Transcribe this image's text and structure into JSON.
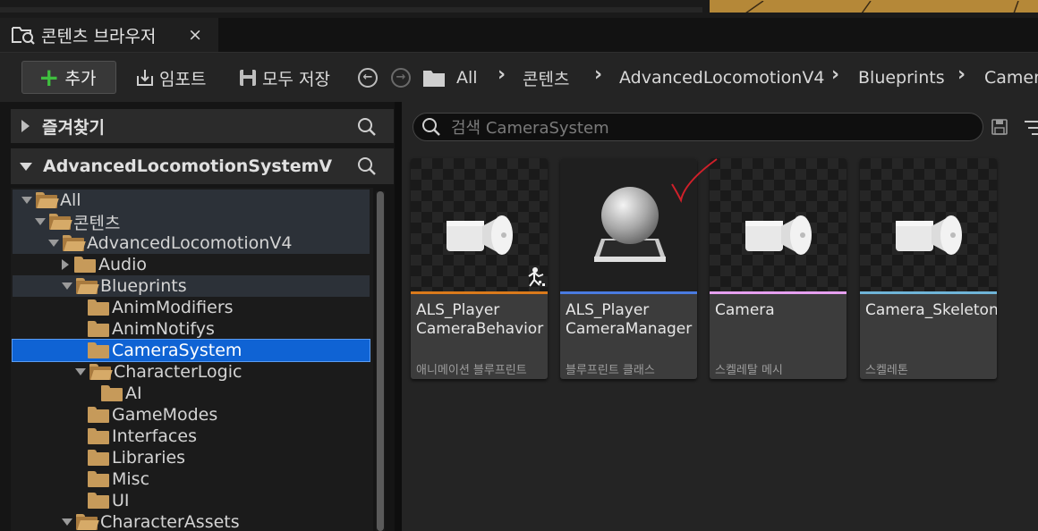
{
  "tab": {
    "title": "콘텐츠 브라우저",
    "close": "×"
  },
  "toolbar": {
    "add_label": "추가",
    "import_label": "임포트",
    "save_all_label": "모두 저장"
  },
  "breadcrumbs": [
    "All",
    "콘텐츠",
    "AdvancedLocomotionV4",
    "Blueprints",
    "Camera"
  ],
  "sidebar": {
    "favorites_title": "즐겨찾기",
    "project_title": "AdvancedLocomotionSystemV",
    "tree": [
      {
        "label": "All",
        "depth": 0,
        "expanded": true,
        "state": "hl"
      },
      {
        "label": "콘텐츠",
        "depth": 1,
        "expanded": true,
        "state": "hl"
      },
      {
        "label": "AdvancedLocomotionV4",
        "depth": 2,
        "expanded": true,
        "state": "hl"
      },
      {
        "label": "Audio",
        "depth": 3,
        "expanded": false,
        "state": ""
      },
      {
        "label": "Blueprints",
        "depth": 3,
        "expanded": true,
        "state": "hl"
      },
      {
        "label": "AnimModifiers",
        "depth": 4,
        "expanded": null,
        "state": ""
      },
      {
        "label": "AnimNotifys",
        "depth": 4,
        "expanded": null,
        "state": ""
      },
      {
        "label": "CameraSystem",
        "depth": 4,
        "expanded": null,
        "state": "sel"
      },
      {
        "label": "CharacterLogic",
        "depth": 4,
        "expanded": true,
        "state": ""
      },
      {
        "label": "AI",
        "depth": 5,
        "expanded": null,
        "state": ""
      },
      {
        "label": "GameModes",
        "depth": 4,
        "expanded": null,
        "state": ""
      },
      {
        "label": "Interfaces",
        "depth": 4,
        "expanded": null,
        "state": ""
      },
      {
        "label": "Libraries",
        "depth": 4,
        "expanded": null,
        "state": ""
      },
      {
        "label": "Misc",
        "depth": 4,
        "expanded": null,
        "state": ""
      },
      {
        "label": "UI",
        "depth": 4,
        "expanded": null,
        "state": ""
      },
      {
        "label": "CharacterAssets",
        "depth": 3,
        "expanded": true,
        "state": ""
      }
    ]
  },
  "search": {
    "placeholder": "검색 CameraSystem"
  },
  "assets": [
    {
      "name_line1": "ALS_Player",
      "name_line2": "CameraBehavior",
      "type": "애니메이션 블루프린트",
      "color": "#d97a1c",
      "icon": "camera-icon"
    },
    {
      "name_line1": "ALS_Player",
      "name_line2": "CameraManager",
      "type": "블루프린트 클래스",
      "color": "#4a7be0",
      "icon": "sphere-icon"
    },
    {
      "name_line1": "Camera",
      "name_line2": "",
      "type": "스켈레탈 메시",
      "color": "#e6a0f0",
      "icon": "camera-icon"
    },
    {
      "name_line1": "Camera_Skeleton",
      "name_line2": "",
      "type": "스켈레톤",
      "color": "#6fb4d8",
      "icon": "camera-icon"
    }
  ],
  "colors": {
    "selection": "#0f63d4",
    "add_plus": "#3fbf3f",
    "folder": "#c69a5a"
  }
}
